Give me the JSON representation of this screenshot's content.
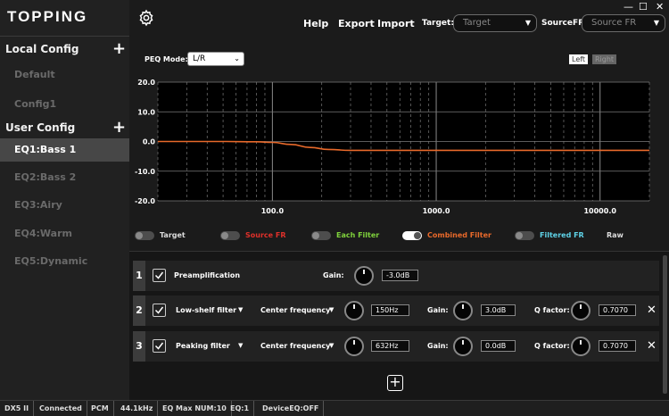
{
  "app": {
    "logo": "TOPPING"
  },
  "window": {
    "minimize": "—",
    "maximize": "☐",
    "close": "✕"
  },
  "header": {
    "help": "Help",
    "export": "Export",
    "import": "Import",
    "target_label": "Target:",
    "target_value": "Target",
    "source_label": "SourceFR:",
    "source_value": "Source FR"
  },
  "sidebar": {
    "local_title": "Local Config",
    "local_items": [
      "Default",
      "Config1"
    ],
    "user_title": "User Config",
    "user_items": [
      "EQ1:Bass 1",
      "EQ2:Bass 2",
      "EQ3:Airy",
      "EQ4:Warm",
      "EQ5:Dynamic"
    ],
    "active_item": "EQ1:Bass 1"
  },
  "peq": {
    "mode_label": "PEQ Mode:",
    "mode_value": "L/R",
    "left": "Left",
    "right": "Right"
  },
  "chart_data": {
    "type": "line",
    "x_scale": "log",
    "xlim": [
      20,
      20000
    ],
    "ylim": [
      -20,
      20
    ],
    "yticks": [
      "20.0",
      "10.0",
      "0.0",
      "-10.0",
      "-20.0"
    ],
    "ytick_values": [
      20,
      10,
      0,
      -10,
      -20
    ],
    "xticks": [
      "100.0",
      "1000.0",
      "10000.0"
    ],
    "xtick_values": [
      100,
      1000,
      10000
    ],
    "grid": true,
    "series": [
      {
        "name": "Combined Filter",
        "color": "#e8692a",
        "points": [
          [
            20,
            0
          ],
          [
            50,
            0
          ],
          [
            80,
            -0.1
          ],
          [
            100,
            -0.3
          ],
          [
            130,
            -1.0
          ],
          [
            170,
            -2.0
          ],
          [
            220,
            -2.7
          ],
          [
            300,
            -3.0
          ],
          [
            632,
            -3.0
          ],
          [
            2000,
            -3.0
          ],
          [
            20000,
            -3.0
          ]
        ]
      }
    ]
  },
  "legend": [
    {
      "label": "Target",
      "color": "#dddddd",
      "on": false
    },
    {
      "label": "Source FR",
      "color": "#e0302a",
      "on": false
    },
    {
      "label": "Each Filter",
      "color": "#7fd23c",
      "on": false
    },
    {
      "label": "Combined Filter",
      "color": "#e8692a",
      "on": true
    },
    {
      "label": "Filtered FR",
      "color": "#5fd3e8",
      "on": false
    },
    {
      "label": "Raw",
      "color": "#dddddd",
      "on": null
    }
  ],
  "filters": [
    {
      "num": "1",
      "name": "Preamplification",
      "gain_label": "Gain:",
      "gain": "-3.0dB"
    },
    {
      "num": "2",
      "name": "Low-shelf filter",
      "freq_label": "Center frequency",
      "freq": "150Hz",
      "gain_label": "Gain:",
      "gain": "3.0dB",
      "q_label": "Q factor:",
      "q": "0.7070"
    },
    {
      "num": "3",
      "name": "Peaking filter",
      "freq_label": "Center frequency",
      "freq": "632Hz",
      "gain_label": "Gain:",
      "gain": "0.0dB",
      "q_label": "Q factor:",
      "q": "0.7070"
    }
  ],
  "add_filter": "+",
  "status": [
    "DX5 II",
    "Connected",
    "PCM",
    "44.1kHz",
    "EQ Max NUM:10",
    "EQ:1",
    "DeviceEQ:OFF"
  ]
}
